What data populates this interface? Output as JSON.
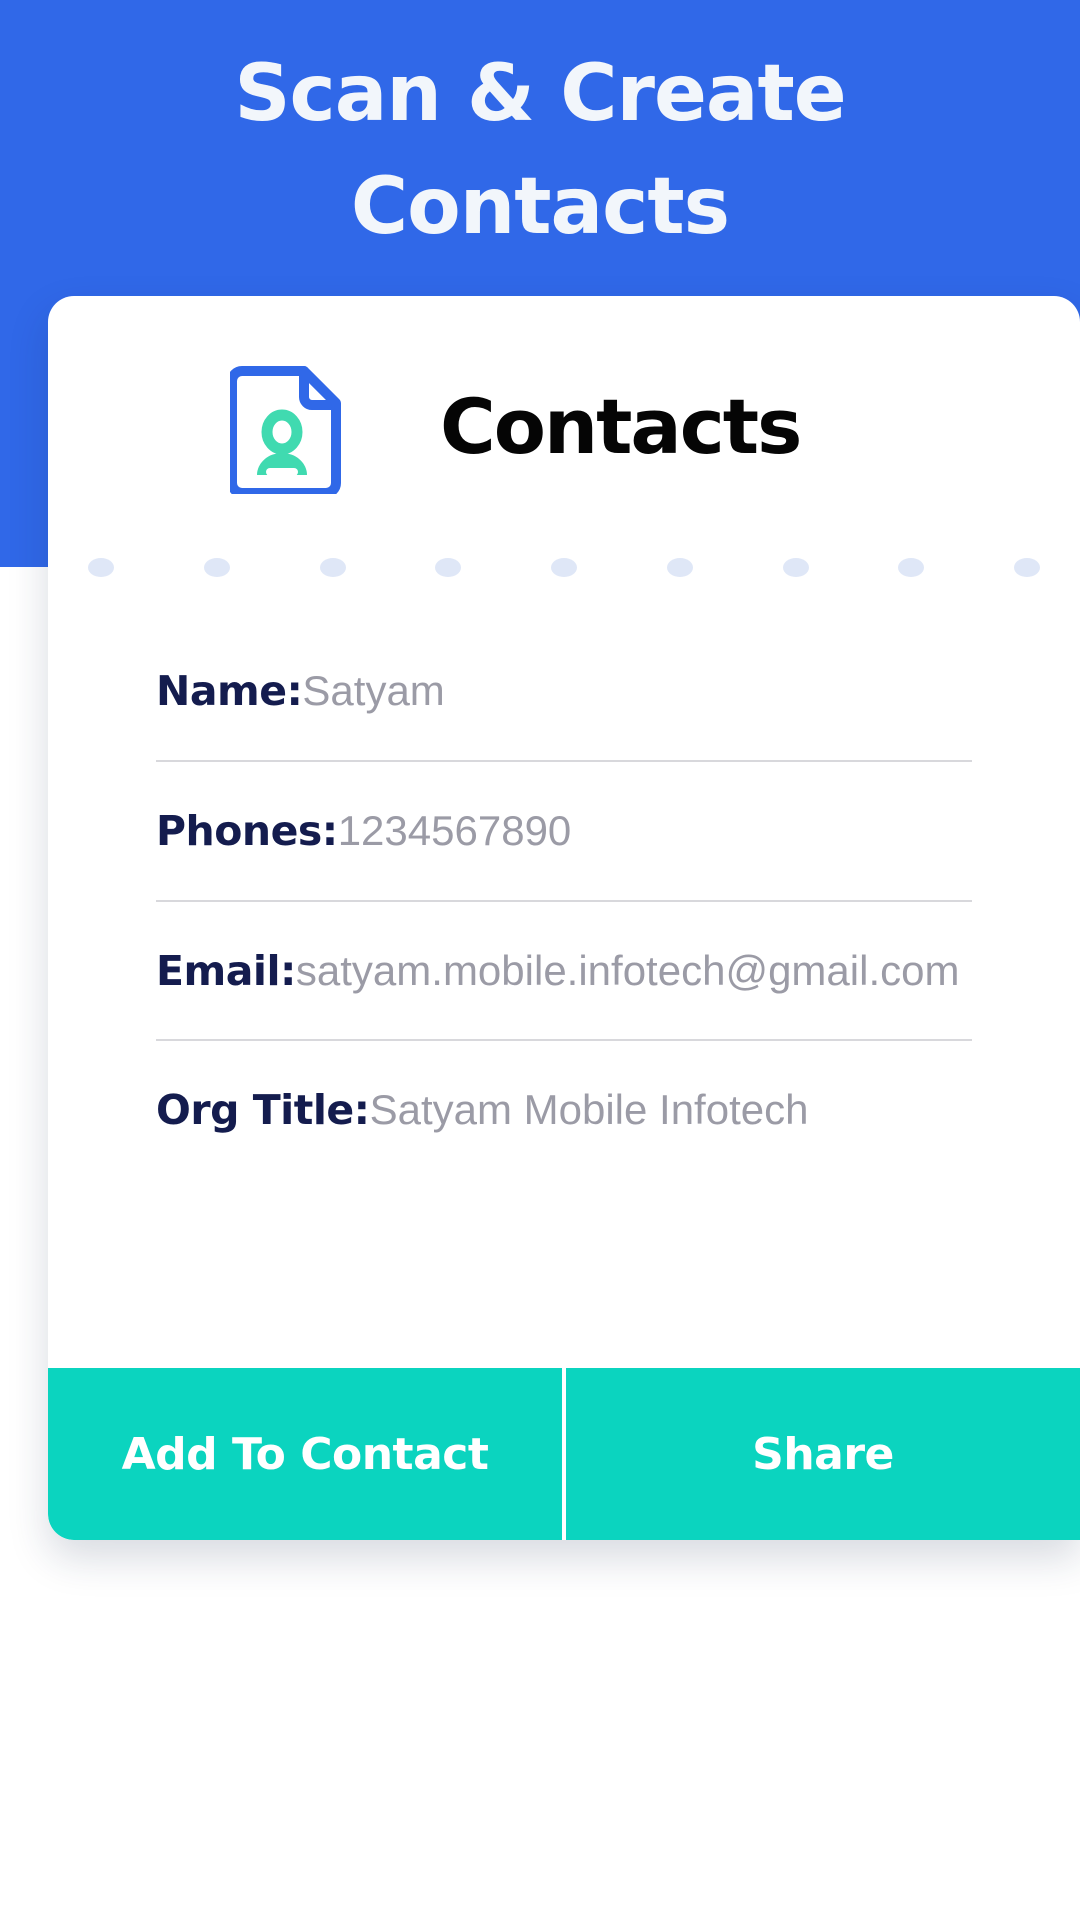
{
  "header": {
    "title": "Scan & Create Contacts",
    "background_color": "#3068e8",
    "text_color": "#f2f6fb"
  },
  "card": {
    "head": {
      "icon": "contact-document-icon",
      "icon_outline_color": "#3068e8",
      "icon_person_color": "#40dab0",
      "title": "Contacts"
    },
    "perforation": {
      "dot_color": "#dfe7f7",
      "dot_count": 9
    },
    "fields": [
      {
        "label": "Name:",
        "value": "Satyam"
      },
      {
        "label": "Phones:",
        "value": "1234567890"
      },
      {
        "label": "Email:",
        "value": "satyam.mobile.infotech@gmail.com"
      },
      {
        "label": "Org Title:",
        "value": "Satyam Mobile Infotech"
      }
    ],
    "label_color": "#141c4e",
    "value_color": "#9b9ba6",
    "divider_color": "#d8d8dc"
  },
  "actions": {
    "background_color": "#0bd4bf",
    "text_color": "#ffffff",
    "add_to_contact_label": "Add To Contact",
    "share_label": "Share"
  }
}
